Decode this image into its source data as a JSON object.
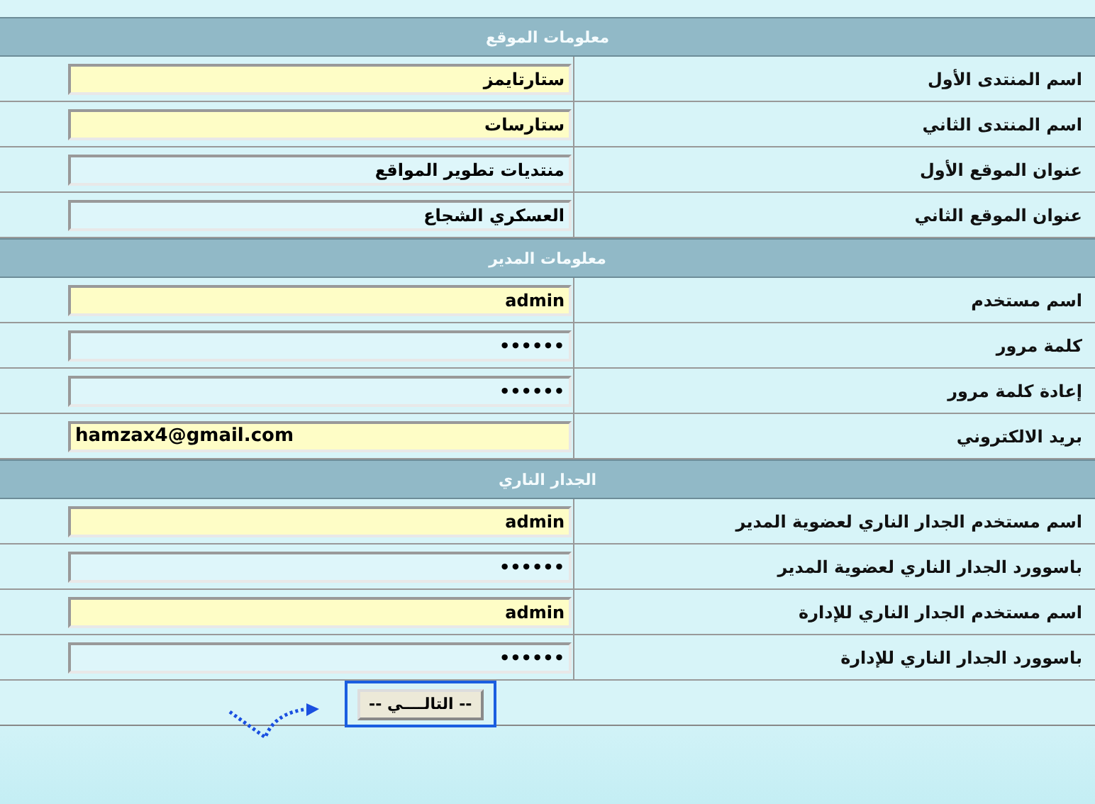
{
  "sections": [
    {
      "title": "معلومات الموقع",
      "fields": [
        {
          "label": "اسم المنتدى الأول",
          "value": "ستارتايمز",
          "kind": "text",
          "highlighted": true
        },
        {
          "label": "اسم المنتدى الثاني",
          "value": "ستارسات",
          "kind": "text",
          "highlighted": true
        },
        {
          "label": "عنوان الموقع الأول",
          "value": "منتديات تطوير المواقع",
          "kind": "text",
          "highlighted": false
        },
        {
          "label": "عنوان الموقع الثاني",
          "value": "العسكري الشجاع",
          "kind": "text",
          "highlighted": false
        }
      ]
    },
    {
      "title": "معلومات المدير",
      "fields": [
        {
          "label": "اسم مستخدم",
          "value": "admin",
          "kind": "text",
          "highlighted": true
        },
        {
          "label": "كلمة مرور",
          "value": "••••••",
          "kind": "password",
          "highlighted": false
        },
        {
          "label": "إعادة كلمة مرور",
          "value": "••••••",
          "kind": "password",
          "highlighted": false
        },
        {
          "label": "بريد الالكتروني",
          "value": "hamzax4@gmail.com",
          "kind": "email",
          "highlighted": true
        }
      ]
    },
    {
      "title": "الجدار الناري",
      "fields": [
        {
          "label": "اسم مستخدم الجدار الناري لعضوية المدير",
          "value": "admin",
          "kind": "text",
          "highlighted": true
        },
        {
          "label": "باسوورد الجدار الناري لعضوية المدير",
          "value": "••••••",
          "kind": "password",
          "highlighted": false
        },
        {
          "label": "اسم مستخدم الجدار الناري للإدارة",
          "value": "admin",
          "kind": "text",
          "highlighted": true
        },
        {
          "label": "باسوورد الجدار الناري للإدارة",
          "value": "••••••",
          "kind": "password",
          "highlighted": false
        }
      ]
    }
  ],
  "next_button": {
    "label": "-- التالــــي --",
    "highlighted": true
  }
}
